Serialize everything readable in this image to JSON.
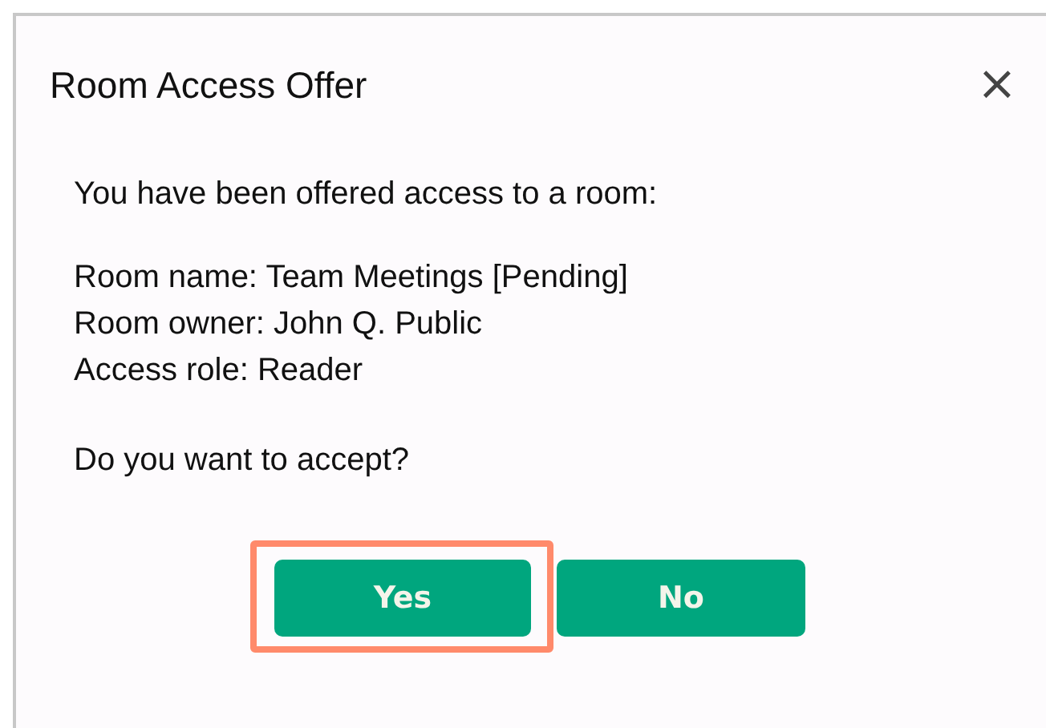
{
  "dialog": {
    "title": "Room Access Offer",
    "close": "×"
  },
  "message": "You have been offered access to a room:",
  "details": [
    "Room name: Team Meetings [Pending]",
    "Room owner: John Q. Public",
    "Access role: Reader"
  ],
  "question": "Do you want to accept?",
  "buttons": [
    {
      "label": "Yes",
      "highlighted": true
    },
    {
      "label": "No",
      "highlighted": false
    }
  ]
}
